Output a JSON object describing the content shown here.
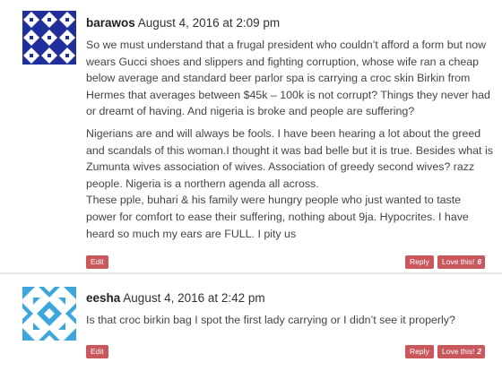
{
  "comments": [
    {
      "author": "barawos",
      "date": "August 4, 2016 at 2:09 pm",
      "paragraphs": [
        "So we must understand that a frugal president who couldn’t afford a form but now wears Gucci shoes and slippers and fighting corruption, whose wife ran a cheap below average and standard beer parlor spa is carrying a croc skin Birkin from Hermes that averages between $45k – 100k is not corrupt? Things they never had or dreamt of having. And nigeria is broke and people are suffering?",
        "Nigerians are and will always be fools. I have been hearing a lot about the greed and scandals of this woman.I thought it was bad belle but it is true. Besides what is Zumunta wives association of wives. Association of greedy second wives? razz people. Nigeria is a northern agenda all across.",
        "These pple, buhari & his family were hungry people who just wanted to taste power for comfort to ease their suffering, nothing about 9ja. Hypocrites. I have heard so much my ears are FULL. I pity us"
      ],
      "edit_label": "Edit",
      "reply_label": "Reply",
      "love_label": "Love this!",
      "love_count": "6",
      "avatar_colors": [
        "#1f2f9b",
        "#ffffff"
      ]
    },
    {
      "author": "eesha",
      "date": "August 4, 2016 at 2:42 pm",
      "paragraphs": [
        "Is that croc birkin bag I spot the first lady carrying or I didn’t see it properly?"
      ],
      "edit_label": "Edit",
      "reply_label": "Reply",
      "love_label": "Love this!",
      "love_count": "2",
      "avatar_colors": [
        "#3ca7dc",
        "#ffffff"
      ]
    }
  ]
}
